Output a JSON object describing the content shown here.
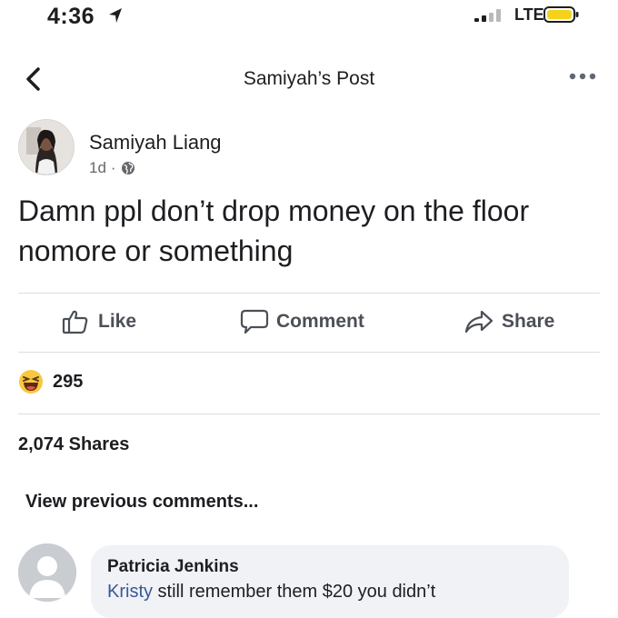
{
  "status_bar": {
    "time": "4:36",
    "carrier": "LTE",
    "battery_color": "#f5d31b"
  },
  "nav": {
    "title": "Samiyah’s Post",
    "back_icon": "chevron-left-icon",
    "more_icon": "more-horizontal-icon"
  },
  "post": {
    "author": "Samiyah Liang",
    "time_ago": "1d",
    "separator": "·",
    "privacy_icon": "globe-icon",
    "text": "Damn ppl don’t drop money on the floor nomore or something"
  },
  "actions": {
    "like_label": "Like",
    "comment_label": "Comment",
    "share_label": "Share"
  },
  "reactions": {
    "emoji": "haha",
    "count": "295"
  },
  "shares_count": "2,074 Shares",
  "comments": {
    "view_previous": "View previous comments...",
    "items": [
      {
        "author": "Patricia Jenkins",
        "mention": "Kristy",
        "text": " still remember them $20 you didn’t"
      }
    ]
  },
  "colors": {
    "text": "#1c1e21",
    "secondary": "#65676b",
    "link": "#385898",
    "divider": "#dadde1"
  }
}
